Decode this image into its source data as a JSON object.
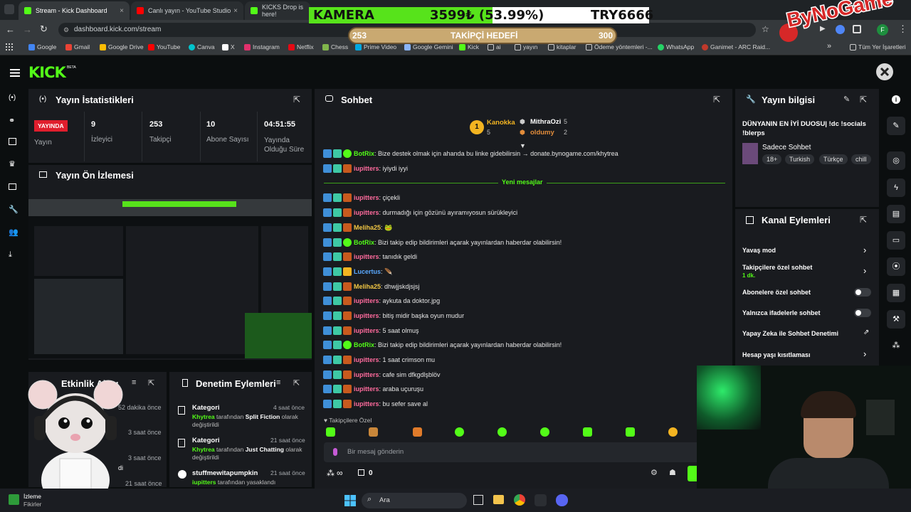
{
  "browser": {
    "tabs": [
      {
        "label": "Stream - Kick Dashboard",
        "close": "×",
        "color": "#53fc18"
      },
      {
        "label": "Canlı yayın - YouTube Studio",
        "close": "×",
        "color": "#ff0000"
      },
      {
        "label": "KICKS Drop is here!",
        "close": "",
        "color": "#53fc18"
      }
    ],
    "url": "dashboard.kick.com/stream",
    "bookmarks": [
      {
        "label": "Google",
        "color": "#4285f4"
      },
      {
        "label": "Gmail",
        "color": "#ea4335"
      },
      {
        "label": "Google Drive",
        "color": "#fbbc04"
      },
      {
        "label": "YouTube",
        "color": "#ff0000"
      },
      {
        "label": "Canva",
        "color": "#00c4cc"
      },
      {
        "label": "X",
        "color": "#ffffff"
      },
      {
        "label": "Instagram",
        "color": "#e1306c"
      },
      {
        "label": "Netflix",
        "color": "#e50914"
      },
      {
        "label": "Chess",
        "color": "#81b64c"
      },
      {
        "label": "Prime Video",
        "color": "#00a8e1"
      },
      {
        "label": "Google Gemini",
        "color": "#8ab4f8"
      },
      {
        "label": "Kick",
        "color": "#53fc18"
      },
      {
        "label": "ai",
        "color": "#cccccc"
      },
      {
        "label": "yayın",
        "color": "#cccccc"
      },
      {
        "label": "kitaplar",
        "color": "#cccccc"
      },
      {
        "label": "Ödeme yöntemleri -...",
        "color": "#cccccc"
      },
      {
        "label": "WhatsApp",
        "color": "#25d366"
      },
      {
        "label": "Ganimet - ARC Raid...",
        "color": "#c0392b"
      },
      {
        "label": "Tüm Yer İşaretleri",
        "color": "#cccccc"
      }
    ],
    "more_bookmarks": "»"
  },
  "overlay": {
    "kamera_label": "KAMERA",
    "kamera_value": "3599₺ (53.99%)",
    "kamera_progress": 0.5399,
    "kamera_code": "TRY6666",
    "goal_start": "253",
    "goal_title": "TAKİPÇİ HEDEFİ",
    "goal_end": "300",
    "goal_progress": 0.0,
    "brand": "ByNoGame"
  },
  "kick": {
    "logo": "KICK",
    "beta": "BETA"
  },
  "stats": {
    "title": "Yayın İstatistikleri",
    "live_badge": "YAYINDA",
    "live_label": "Yayın",
    "items": [
      {
        "value": "9",
        "label": "İzleyici"
      },
      {
        "value": "253",
        "label": "Takipçi"
      },
      {
        "value": "10",
        "label": "Abone Sayısı"
      },
      {
        "value": "04:51:55",
        "label": "Yayında Olduğu Süre"
      }
    ]
  },
  "preview": {
    "title": "Yayın Ön İzlemesi"
  },
  "activity": {
    "title": "Etkinlik Akışı",
    "times": [
      "52 dakika önce",
      "3 saat önce",
      "3 saat önce",
      "21 saat önce"
    ],
    "partial": "di"
  },
  "moderation": {
    "title": "Denetim Eylemleri",
    "items": [
      {
        "title": "Kategori",
        "time": "4 saat önce",
        "user": "Khytrea",
        "mid": "tarafından",
        "target": "Split Fiction",
        "suffix": "olarak değiştirildi"
      },
      {
        "title": "Kategori",
        "time": "21 saat önce",
        "user": "Khytrea",
        "mid": "tarafından",
        "target": "Just Chatting",
        "suffix": "olarak değiştirildi"
      },
      {
        "title": "stuffmewitapumpkin",
        "time": "21 saat önce",
        "user": "iupitters",
        "mid": "tarafından yasaklandı",
        "target": "",
        "suffix": ""
      }
    ]
  },
  "chat": {
    "title": "Sohbet",
    "leaders": [
      {
        "rank": "1",
        "name": "Kanokka",
        "count": "5"
      },
      {
        "rank": "",
        "name": "MithraOzi",
        "count": "5"
      },
      {
        "rank": "",
        "name": "oldumy",
        "count": "2"
      }
    ],
    "divider": "Yeni mesajlar",
    "messages": [
      {
        "user": "BotRix",
        "color": "#53fc18",
        "text": ": Bize destek olmak için ahanda bu linke gidebilirsin → donate.bynogame.com/khytrea"
      },
      {
        "user": "iupitters",
        "color": "#ff6b9d",
        "text": ": iyiydi iyyi"
      },
      {
        "user": "iupitters",
        "color": "#ff6b9d",
        "text": ": çiçekli"
      },
      {
        "user": "iupitters",
        "color": "#ff6b9d",
        "text": ": durmadığı için gözünü ayıramıyosun sürükleyici"
      },
      {
        "user": "Meliha25",
        "color": "#f2c744",
        "text": ": 🐸"
      },
      {
        "user": "BotRix",
        "color": "#53fc18",
        "text": ": Bizi takip edip bildirimleri açarak yayınlardan haberdar olabilirsin!"
      },
      {
        "user": "iupitters",
        "color": "#ff6b9d",
        "text": ": tanıdık geldi"
      },
      {
        "user": "Lucertus",
        "color": "#5aa9ff",
        "text": ": 🪶"
      },
      {
        "user": "Meliha25",
        "color": "#f2c744",
        "text": ": dhwjjskdjsjsj"
      },
      {
        "user": "iupitters",
        "color": "#ff6b9d",
        "text": ": aykuta da doktor.jpg"
      },
      {
        "user": "iupitters",
        "color": "#ff6b9d",
        "text": ": bitiş midir başka oyun mudur"
      },
      {
        "user": "iupitters",
        "color": "#ff6b9d",
        "text": ": 5 saat olmuş"
      },
      {
        "user": "BotRix",
        "color": "#53fc18",
        "text": ": Bizi takip edip bildirimleri açarak yayınlardan haberdar olabilirsin!"
      },
      {
        "user": "iupitters",
        "color": "#ff6b9d",
        "text": ": 1 saat crimson mu"
      },
      {
        "user": "iupitters",
        "color": "#ff6b9d",
        "text": ": cafe sim dfkgdlşblöv"
      },
      {
        "user": "iupitters",
        "color": "#ff6b9d",
        "text": ": araba uçuruşu"
      },
      {
        "user": "iupitters",
        "color": "#ff6b9d",
        "text": ": bu sefer save al"
      }
    ],
    "followers_only": "Takipçilere Özel",
    "input_placeholder": "Bir mesaj gönderin",
    "points": "∞",
    "gifts": "0"
  },
  "info": {
    "title": "Yayın bilgisi",
    "stream_title": "DÜNYANIN EN İYİ DUOSU| !dc !socials !blerps",
    "category": "Sadece Sohbet",
    "tags": [
      "18+",
      "Turkish",
      "Türkçe",
      "chill"
    ]
  },
  "actions": {
    "title": "Kanal Eylemleri",
    "items": [
      {
        "label": "Yavaş mod",
        "sub": ""
      },
      {
        "label": "Takipçilere özel sohbet",
        "sub": "1 dk."
      },
      {
        "label": "Abonelere özel sohbet",
        "sub": ""
      },
      {
        "label": "Yalnızca ifadelerle sohbet",
        "sub": ""
      },
      {
        "label": "Yapay Zeka ile Sohbet Denetimi",
        "sub": ""
      },
      {
        "label": "Hesap yaşı kısıtlaması",
        "sub": ""
      }
    ]
  },
  "taskbar": {
    "widget_line1": "İzleme",
    "widget_line2": "Fikirler",
    "search": "Ara"
  },
  "colors": {
    "kick_green": "#53fc18",
    "panel": "#191b1f",
    "bg": "#0b0e0f",
    "live_red": "#e01e2d"
  }
}
